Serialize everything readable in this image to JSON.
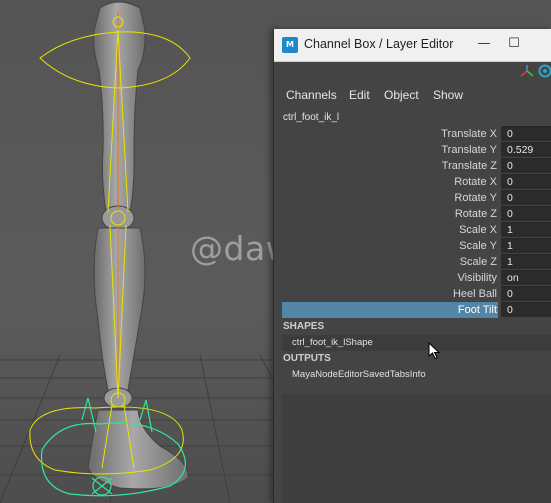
{
  "watermark": "@dawn_arc",
  "window": {
    "title": "Channel Box / Layer Editor",
    "logo_text": "M",
    "minimize_glyph": "—",
    "maximize_glyph": "☐"
  },
  "menu": [
    "Channels",
    "Edit",
    "Object",
    "Show"
  ],
  "node_name": "ctrl_foot_ik_l",
  "channels": [
    {
      "label": "Translate X",
      "value": "0"
    },
    {
      "label": "Translate Y",
      "value": "0.529"
    },
    {
      "label": "Translate Z",
      "value": "0"
    },
    {
      "label": "Rotate X",
      "value": "0"
    },
    {
      "label": "Rotate Y",
      "value": "0"
    },
    {
      "label": "Rotate Z",
      "value": "0"
    },
    {
      "label": "Scale X",
      "value": "1"
    },
    {
      "label": "Scale Y",
      "value": "1"
    },
    {
      "label": "Scale Z",
      "value": "1"
    },
    {
      "label": "Visibility",
      "value": "on"
    },
    {
      "label": "Heel Ball",
      "value": "0"
    },
    {
      "label": "Foot Tilt",
      "value": "0",
      "selected": true
    }
  ],
  "shapes": {
    "heading": "SHAPES",
    "item": "ctrl_foot_ik_lShape"
  },
  "outputs": {
    "heading": "OUTPUTS",
    "item": "MayaNodeEditorSavedTabsInfo"
  },
  "colors": {
    "selection": "#5285a6",
    "ik_curve": "#e6e600",
    "foot_control": "#33e699",
    "bone": "#e0742c"
  },
  "icons": [
    "axis-icon",
    "channel-box-icon",
    "mouse-cursor-icon"
  ]
}
